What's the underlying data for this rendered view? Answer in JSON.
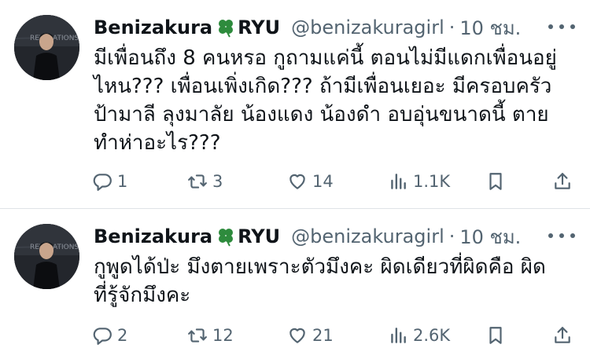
{
  "tweets": [
    {
      "display_name": "Benizakura",
      "name_suffix": "RYU",
      "handle": "@benizakuragirl",
      "separator": "·",
      "time": "10 ชม.",
      "text": "มีเพื่อนถึง 8 คนหรอ กูถามแค่นี้ ตอนไม่มีแดกเพื่อนอยู่\nไหน??? เพื่อนเพิ่งเกิด??? ถ้ามีเพื่อนเยอะ มีครอบครัว\nป้ามาลี ลุงมาลัย น้องแดง น้องดำ อบอุ่นขนาดนี้ ตาย\nทำห่าอะไร???",
      "replies": "1",
      "retweets": "3",
      "likes": "14",
      "views": "1.1K"
    },
    {
      "display_name": "Benizakura",
      "name_suffix": "RYU",
      "handle": "@benizakuragirl",
      "separator": "·",
      "time": "10 ชม.",
      "text": "กูพูดได้ป่ะ มึงตายเพราะตัวมึงคะ ผิดเดียวที่ผิดคือ ผิด\nที่รู้จักมึงคะ",
      "replies": "2",
      "retweets": "12",
      "likes": "21",
      "views": "2.6K"
    }
  ],
  "icons": {
    "name_emoji": "four-leaf-clover-icon",
    "reply": "reply-icon",
    "retweet": "retweet-icon",
    "like": "heart-icon",
    "views": "views-icon",
    "bookmark": "bookmark-icon",
    "share": "share-icon",
    "more": "more-icon"
  },
  "colors": {
    "text": "#0f1419",
    "secondary": "#536471",
    "clover": "#2e8b3d",
    "divider": "#dfe3e7",
    "background": "#ffffff"
  }
}
